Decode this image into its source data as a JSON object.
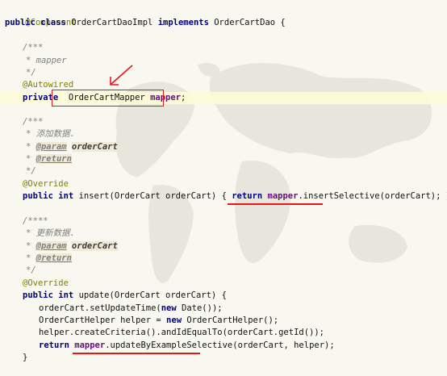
{
  "colors": {
    "keyword": "#00007f",
    "annotation": "#808000",
    "comment": "#808080",
    "field": "#660e7a",
    "markup": "#e8151b"
  },
  "code": {
    "class_annotation": "@Component",
    "class_decl": {
      "kw1": "public",
      "kw2": "class",
      "name": "OrderCartDaoImpl",
      "kw3": "implements",
      "iface": "OrderCartDao",
      "brace": "{"
    },
    "mapper_doc": {
      "open": "/***",
      "text": "* mapper",
      "close": "*/"
    },
    "autowired": "@Autowired",
    "field_decl": {
      "kw": "private",
      "type": "OrderCartMapper",
      "name": "mapper",
      "semi": ";"
    },
    "insert_doc": {
      "open": "/***",
      "text": "* 添加数据.",
      "param_tag": "@param",
      "param_name": "orderCart",
      "return_tag": "@return",
      "close": "*/"
    },
    "override1": "@Override",
    "insert_sig": {
      "kw1": "public",
      "kw2": "int",
      "sig": "insert(OrderCart orderCart)",
      "brace_open": "{",
      "kw3": "return",
      "field": "mapper",
      "call": ".insertSelective(orderCart);",
      "brace_close": "}"
    },
    "update_doc": {
      "open": "/****",
      "text": "* 更新数据.",
      "param_tag": "@param",
      "param_name": "orderCart",
      "return_tag": "@return",
      "close": "*/"
    },
    "override2": "@Override",
    "update_sig": {
      "kw1": "public",
      "kw2": "int",
      "sig": "update(OrderCart orderCart) {"
    },
    "update_body": {
      "l1_a": "orderCart.setUpdateTime(",
      "l1_kw": "new",
      "l1_b": " Date());",
      "l2_a": "OrderCartHelper helper = ",
      "l2_kw": "new",
      "l2_b": " OrderCartHelper();",
      "l3": "helper.createCriteria().andIdEqualTo(orderCart.getId());",
      "l4_kw": "return",
      "l4_field": "mapper",
      "l4_call": ".updateByExampleSelective(orderCart, helper);"
    },
    "close_brace": "}"
  }
}
